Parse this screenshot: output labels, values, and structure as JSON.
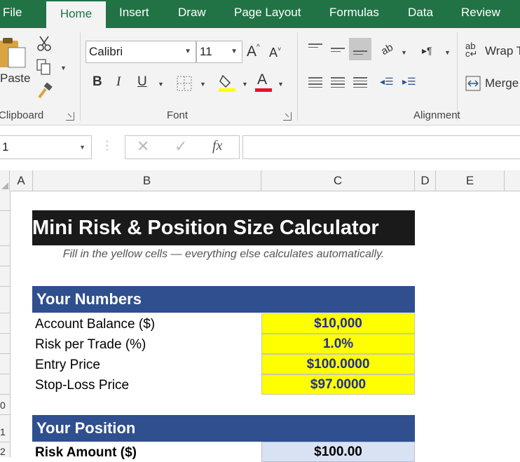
{
  "tabs": [
    {
      "label": "File",
      "active": false
    },
    {
      "label": "Home",
      "active": true
    },
    {
      "label": "Insert",
      "active": false
    },
    {
      "label": "Draw",
      "active": false
    },
    {
      "label": "Page Layout",
      "active": false
    },
    {
      "label": "Formulas",
      "active": false
    },
    {
      "label": "Data",
      "active": false
    },
    {
      "label": "Review",
      "active": false
    }
  ],
  "ribbon": {
    "clipboard": {
      "paste_label": "Paste",
      "group_label": "Clipboard"
    },
    "font": {
      "font_name": "Calibri",
      "font_size": "11",
      "grow_font": "A",
      "shrink_font": "A",
      "bold": "B",
      "italic": "I",
      "underline": "U",
      "font_color_letter": "A",
      "highlight_color": "#ffff00",
      "font_color": "#e81123",
      "group_label": "Font"
    },
    "alignment": {
      "wrap_label": "Wrap T",
      "merge_label": "Merge",
      "group_label": "Alignment"
    }
  },
  "formula_bar": {
    "name_box": "1",
    "fx": "fx",
    "formula": ""
  },
  "columns": [
    "A",
    "B",
    "C",
    "D",
    "E"
  ],
  "rows": [
    "0",
    "1",
    "2"
  ],
  "sheet": {
    "title": "Mini Risk & Position Size Calculator",
    "subtitle": "Fill in the yellow cells — everything else calculates automatically.",
    "input_color": "#ffff00",
    "header_color": "#2f4f8f",
    "your_numbers": {
      "header": "Your Numbers",
      "rows": [
        {
          "label": "Account Balance ($)",
          "value": "$10,000"
        },
        {
          "label": "Risk per Trade (%)",
          "value": "1.0%"
        },
        {
          "label": "Entry Price",
          "value": "$100.0000"
        },
        {
          "label": "Stop-Loss Price",
          "value": "$97.0000"
        }
      ]
    },
    "your_position": {
      "header": "Your Position",
      "rows": [
        {
          "label": "Risk Amount ($)",
          "value": "$100.00"
        }
      ]
    }
  }
}
